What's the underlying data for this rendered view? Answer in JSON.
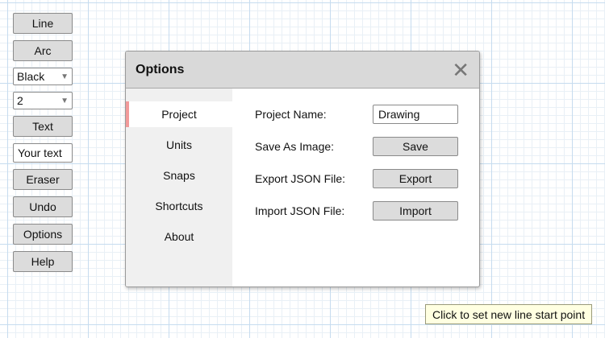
{
  "toolbar": {
    "line": "Line",
    "arc": "Arc",
    "color": {
      "value": "Black",
      "arrow_icon": "triangle-down"
    },
    "width": {
      "value": "2",
      "arrow_icon": "triangle-down"
    },
    "text": "Text",
    "text_input_value": "Your text",
    "eraser": "Eraser",
    "undo": "Undo",
    "options": "Options",
    "help": "Help"
  },
  "dialog": {
    "title": "Options",
    "close_icon": "close-x",
    "nav": [
      "Project",
      "Units",
      "Snaps",
      "Shortcuts",
      "About"
    ],
    "active_nav": "Project",
    "project": {
      "name_label": "Project Name:",
      "name_value": "Drawing",
      "save_label": "Save As Image:",
      "save_button": "Save",
      "export_label": "Export JSON File:",
      "export_button": "Export",
      "import_label": "Import JSON File:",
      "import_button": "Import"
    }
  },
  "status_tooltip": "Click to set new line start point",
  "colors": {
    "accent": "#f29a9a",
    "tooltip_bg": "#ffffe1",
    "grid": "#c6dcef"
  }
}
